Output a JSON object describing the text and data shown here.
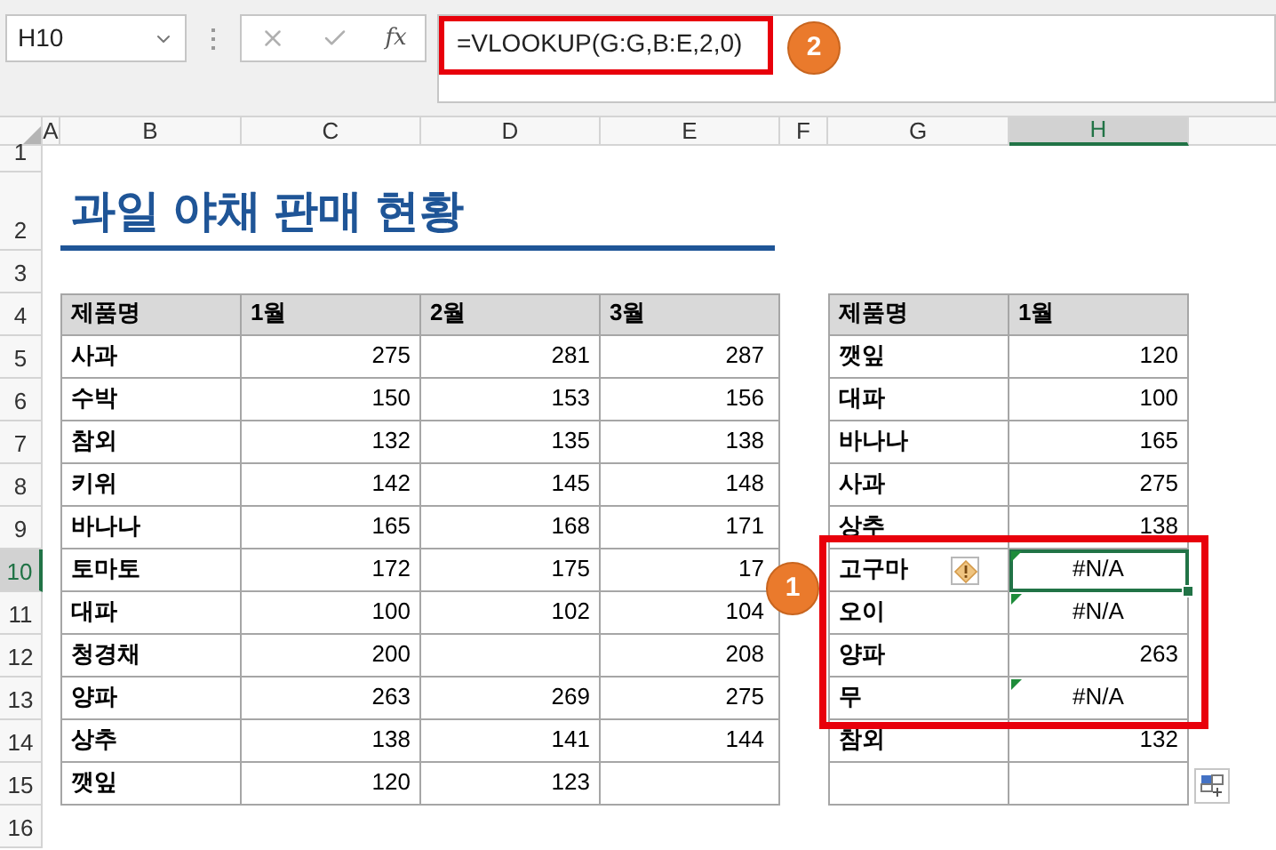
{
  "name_box": {
    "value": "H10"
  },
  "formula_bar": {
    "fx_label": "fx",
    "formula": "=VLOOKUP(G:G,B:E,2,0)"
  },
  "callouts": [
    {
      "label": "2"
    },
    {
      "label": "1"
    }
  ],
  "column_headers": [
    {
      "label": "A",
      "selected": false
    },
    {
      "label": "B",
      "selected": false
    },
    {
      "label": "C",
      "selected": false
    },
    {
      "label": "D",
      "selected": false
    },
    {
      "label": "E",
      "selected": false
    },
    {
      "label": "F",
      "selected": false
    },
    {
      "label": "G",
      "selected": false
    },
    {
      "label": "H",
      "selected": true
    }
  ],
  "row_headers": [
    {
      "label": "1",
      "selected": false
    },
    {
      "label": "2",
      "selected": false
    },
    {
      "label": "3",
      "selected": false
    },
    {
      "label": "4",
      "selected": false
    },
    {
      "label": "5",
      "selected": false
    },
    {
      "label": "6",
      "selected": false
    },
    {
      "label": "7",
      "selected": false
    },
    {
      "label": "8",
      "selected": false
    },
    {
      "label": "9",
      "selected": false
    },
    {
      "label": "10",
      "selected": true
    },
    {
      "label": "11",
      "selected": false
    },
    {
      "label": "12",
      "selected": false
    },
    {
      "label": "13",
      "selected": false
    },
    {
      "label": "14",
      "selected": false
    },
    {
      "label": "15",
      "selected": false
    },
    {
      "label": "16",
      "selected": false
    }
  ],
  "title": "과일 야채 판매 현황",
  "sales_table": {
    "columns": [
      "제품명",
      "1월",
      "2월",
      "3월"
    ],
    "rows": [
      [
        "사과",
        "275",
        "281",
        "287"
      ],
      [
        "수박",
        "150",
        "153",
        "156"
      ],
      [
        "참외",
        "132",
        "135",
        "138"
      ],
      [
        "키위",
        "142",
        "145",
        "148"
      ],
      [
        "바나나",
        "165",
        "168",
        "171"
      ],
      [
        "토마토",
        "172",
        "175",
        "17"
      ],
      [
        "대파",
        "100",
        "102",
        "104"
      ],
      [
        "청경채",
        "200",
        null,
        "208"
      ],
      [
        "양파",
        "263",
        "269",
        "275"
      ],
      [
        "상추",
        "138",
        "141",
        "144"
      ],
      [
        "깻잎",
        "120",
        "123",
        null
      ]
    ]
  },
  "lookup_table": {
    "columns": [
      "제품명",
      "1월"
    ],
    "rows": [
      {
        "name": "깻잎",
        "value": "120",
        "error": false,
        "warning": false,
        "selected": false
      },
      {
        "name": "대파",
        "value": "100",
        "error": false,
        "warning": false,
        "selected": false
      },
      {
        "name": "바나나",
        "value": "165",
        "error": false,
        "warning": false,
        "selected": false
      },
      {
        "name": "사과",
        "value": "275",
        "error": false,
        "warning": false,
        "selected": false
      },
      {
        "name": "상추",
        "value": "138",
        "error": false,
        "warning": false,
        "selected": false
      },
      {
        "name": "고구마",
        "value": "#N/A",
        "error": true,
        "warning": true,
        "selected": true
      },
      {
        "name": "오이",
        "value": "#N/A",
        "error": true,
        "warning": false,
        "selected": false
      },
      {
        "name": "양파",
        "value": "263",
        "error": false,
        "warning": false,
        "selected": false
      },
      {
        "name": "무",
        "value": "#N/A",
        "error": true,
        "warning": false,
        "selected": false
      },
      {
        "name": "참외",
        "value": "132",
        "error": false,
        "warning": false,
        "selected": false
      },
      {
        "name": null,
        "value": null,
        "error": false,
        "warning": false,
        "selected": false
      }
    ]
  }
}
